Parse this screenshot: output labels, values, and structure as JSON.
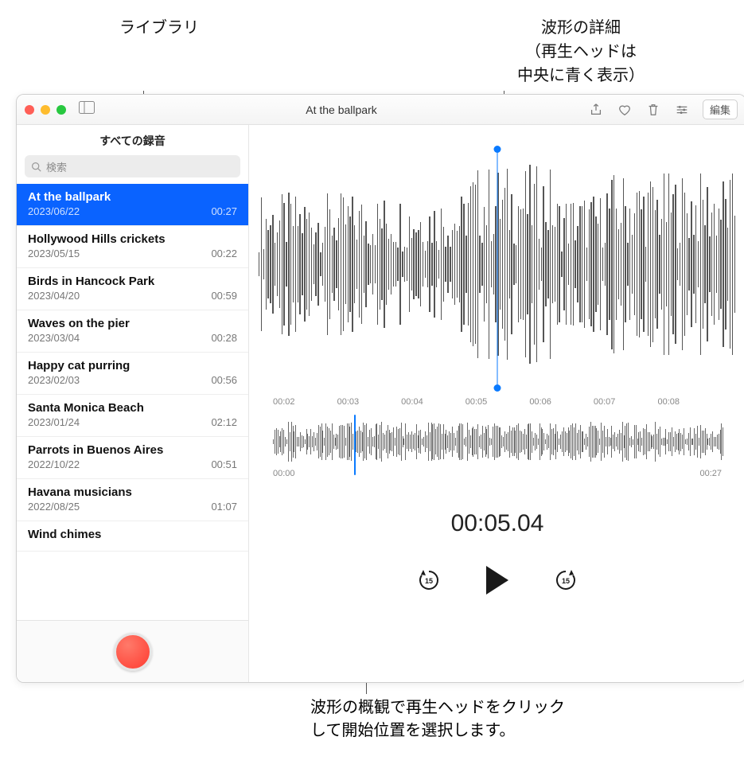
{
  "callouts": {
    "library": "ライブラリ",
    "waveform_detail_l1": "波形の詳細",
    "waveform_detail_l2": "（再生ヘッドは",
    "waveform_detail_l3": "中央に青く表示）",
    "overview_l1": "波形の概観で再生ヘッドをクリック",
    "overview_l2": "して開始位置を選択します。"
  },
  "titlebar": {
    "title": "At the ballpark",
    "edit_label": "編集"
  },
  "sidebar": {
    "header": "すべての録音",
    "search_placeholder": "検索"
  },
  "recordings": [
    {
      "name": "At the ballpark",
      "date": "2023/06/22",
      "dur": "00:27",
      "selected": true
    },
    {
      "name": "Hollywood Hills crickets",
      "date": "2023/05/15",
      "dur": "00:22"
    },
    {
      "name": "Birds in Hancock Park",
      "date": "2023/04/20",
      "dur": "00:59"
    },
    {
      "name": "Waves on the pier",
      "date": "2023/03/04",
      "dur": "00:28"
    },
    {
      "name": "Happy cat purring",
      "date": "2023/02/03",
      "dur": "00:56"
    },
    {
      "name": "Santa Monica Beach",
      "date": "2023/01/24",
      "dur": "02:12"
    },
    {
      "name": "Parrots in Buenos Aires",
      "date": "2022/10/22",
      "dur": "00:51"
    },
    {
      "name": "Havana musicians",
      "date": "2022/08/25",
      "dur": "01:07"
    },
    {
      "name": "Wind chimes",
      "date": "",
      "dur": ""
    }
  ],
  "detail": {
    "ticks": [
      "00:02",
      "00:03",
      "00:04",
      "00:05",
      "00:06",
      "00:07",
      "00:08"
    ]
  },
  "overview": {
    "start": "00:00",
    "end": "00:27"
  },
  "playback": {
    "current_time": "00:05.04",
    "skip_back_seconds": "15",
    "skip_fwd_seconds": "15"
  },
  "colors": {
    "accent": "#0a7aff",
    "selection": "#0a63ff",
    "record": "#ff3b30"
  }
}
